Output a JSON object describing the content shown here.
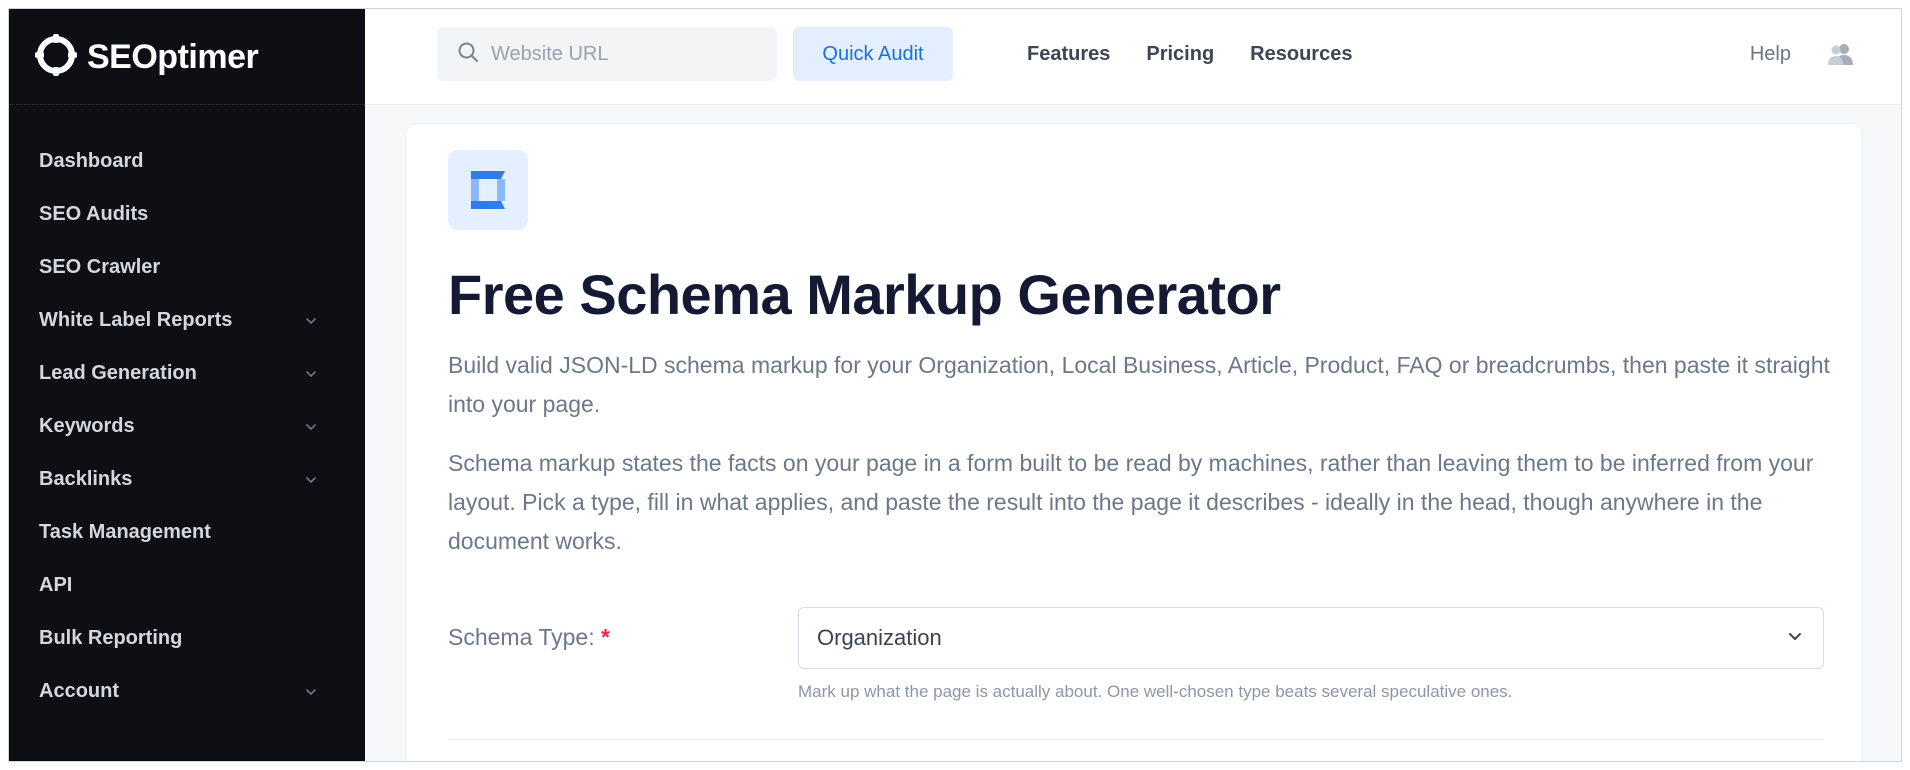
{
  "brand": {
    "logo_text": "SEOptimer",
    "accent": "#1d6fdc"
  },
  "sidebar": {
    "items": [
      {
        "label": "Dashboard",
        "has_chevron": false
      },
      {
        "label": "SEO Audits",
        "has_chevron": false
      },
      {
        "label": "SEO Crawler",
        "has_chevron": false
      },
      {
        "label": "White Label Reports",
        "has_chevron": true
      },
      {
        "label": "Lead Generation",
        "has_chevron": true
      },
      {
        "label": "Keywords",
        "has_chevron": true
      },
      {
        "label": "Backlinks",
        "has_chevron": true
      },
      {
        "label": "Task Management",
        "has_chevron": false
      },
      {
        "label": "API",
        "has_chevron": false
      },
      {
        "label": "Bulk Reporting",
        "has_chevron": false
      },
      {
        "label": "Account",
        "has_chevron": true
      }
    ]
  },
  "header": {
    "search": {
      "placeholder": "Website URL",
      "value": "",
      "icon": "search-icon"
    },
    "quick_audit_label": "Quick Audit",
    "links": [
      "Features",
      "Pricing",
      "Resources"
    ],
    "help_label": "Help",
    "user_icon": "users-icon"
  },
  "main": {
    "title": "Free Schema Markup Generator",
    "intro": "Build valid JSON-LD schema markup for your Organization, Local Business, Article, Product, FAQ or breadcrumbs, then paste it straight into your page.",
    "intro2": "Schema markup states the facts on your page in a form built to be read by machines, rather than leaving them to be inferred from your layout. Pick a type, fill in what applies, and paste the result into the page it describes - ideally in the head, though anywhere in the document works.",
    "form": {
      "schema_type_label": "Schema Type:",
      "required_marker": "*",
      "schema_type_value": "Organization",
      "schema_type_hint": "Mark up what the page is actually about. One well-chosen type beats several speculative ones."
    }
  }
}
